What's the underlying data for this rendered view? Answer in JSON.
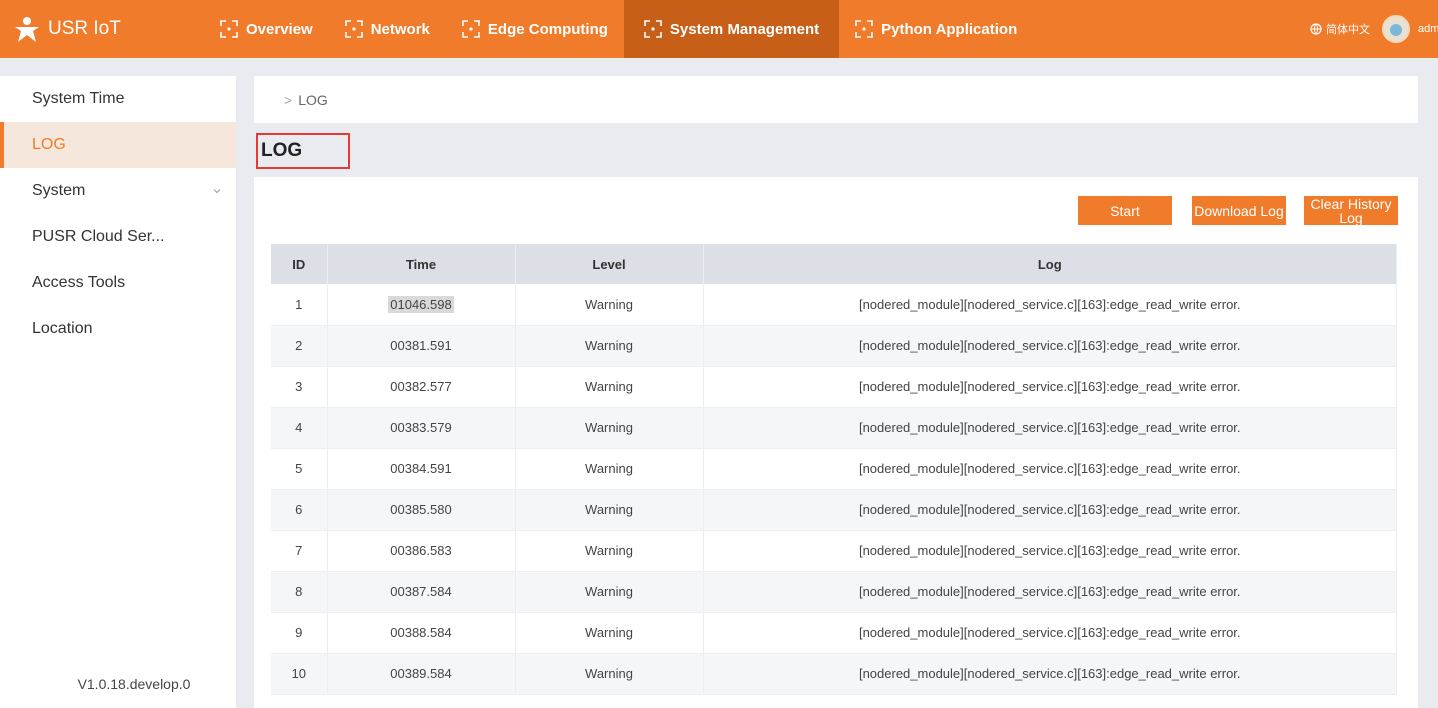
{
  "brand": {
    "name": "USR IoT"
  },
  "nav": [
    {
      "label": "Overview"
    },
    {
      "label": "Network"
    },
    {
      "label": "Edge Computing"
    },
    {
      "label": "System Management"
    },
    {
      "label": "Python Application"
    }
  ],
  "active_nav": "System Management",
  "header_right": {
    "language": "简体中文",
    "user": "admin"
  },
  "sidebar": {
    "items": [
      {
        "label": "System Time"
      },
      {
        "label": "LOG"
      },
      {
        "label": "System"
      },
      {
        "label": "PUSR Cloud Ser..."
      },
      {
        "label": "Access Tools"
      },
      {
        "label": "Location"
      }
    ],
    "active": "LOG",
    "version": "V1.0.18.develop.0"
  },
  "breadcrumb": {
    "current": "LOG"
  },
  "page_title": "LOG",
  "buttons": {
    "start": "Start",
    "download": "Download Log",
    "clear": "Clear History Log"
  },
  "table": {
    "columns": [
      "ID",
      "Time",
      "Level",
      "Log"
    ],
    "rows": [
      {
        "id": "1",
        "time": "01046.598",
        "level": "Warning",
        "log": "[nodered_module][nodered_service.c][163]:edge_read_write error."
      },
      {
        "id": "2",
        "time": "00381.591",
        "level": "Warning",
        "log": "[nodered_module][nodered_service.c][163]:edge_read_write error."
      },
      {
        "id": "3",
        "time": "00382.577",
        "level": "Warning",
        "log": "[nodered_module][nodered_service.c][163]:edge_read_write error."
      },
      {
        "id": "4",
        "time": "00383.579",
        "level": "Warning",
        "log": "[nodered_module][nodered_service.c][163]:edge_read_write error."
      },
      {
        "id": "5",
        "time": "00384.591",
        "level": "Warning",
        "log": "[nodered_module][nodered_service.c][163]:edge_read_write error."
      },
      {
        "id": "6",
        "time": "00385.580",
        "level": "Warning",
        "log": "[nodered_module][nodered_service.c][163]:edge_read_write error."
      },
      {
        "id": "7",
        "time": "00386.583",
        "level": "Warning",
        "log": "[nodered_module][nodered_service.c][163]:edge_read_write error."
      },
      {
        "id": "8",
        "time": "00387.584",
        "level": "Warning",
        "log": "[nodered_module][nodered_service.c][163]:edge_read_write error."
      },
      {
        "id": "9",
        "time": "00388.584",
        "level": "Warning",
        "log": "[nodered_module][nodered_service.c][163]:edge_read_write error."
      },
      {
        "id": "10",
        "time": "00389.584",
        "level": "Warning",
        "log": "[nodered_module][nodered_service.c][163]:edge_read_write error."
      }
    ]
  },
  "colors": {
    "accent": "#f07c2b",
    "accent_dark": "#c75f18",
    "highlight_border": "#e53935"
  }
}
